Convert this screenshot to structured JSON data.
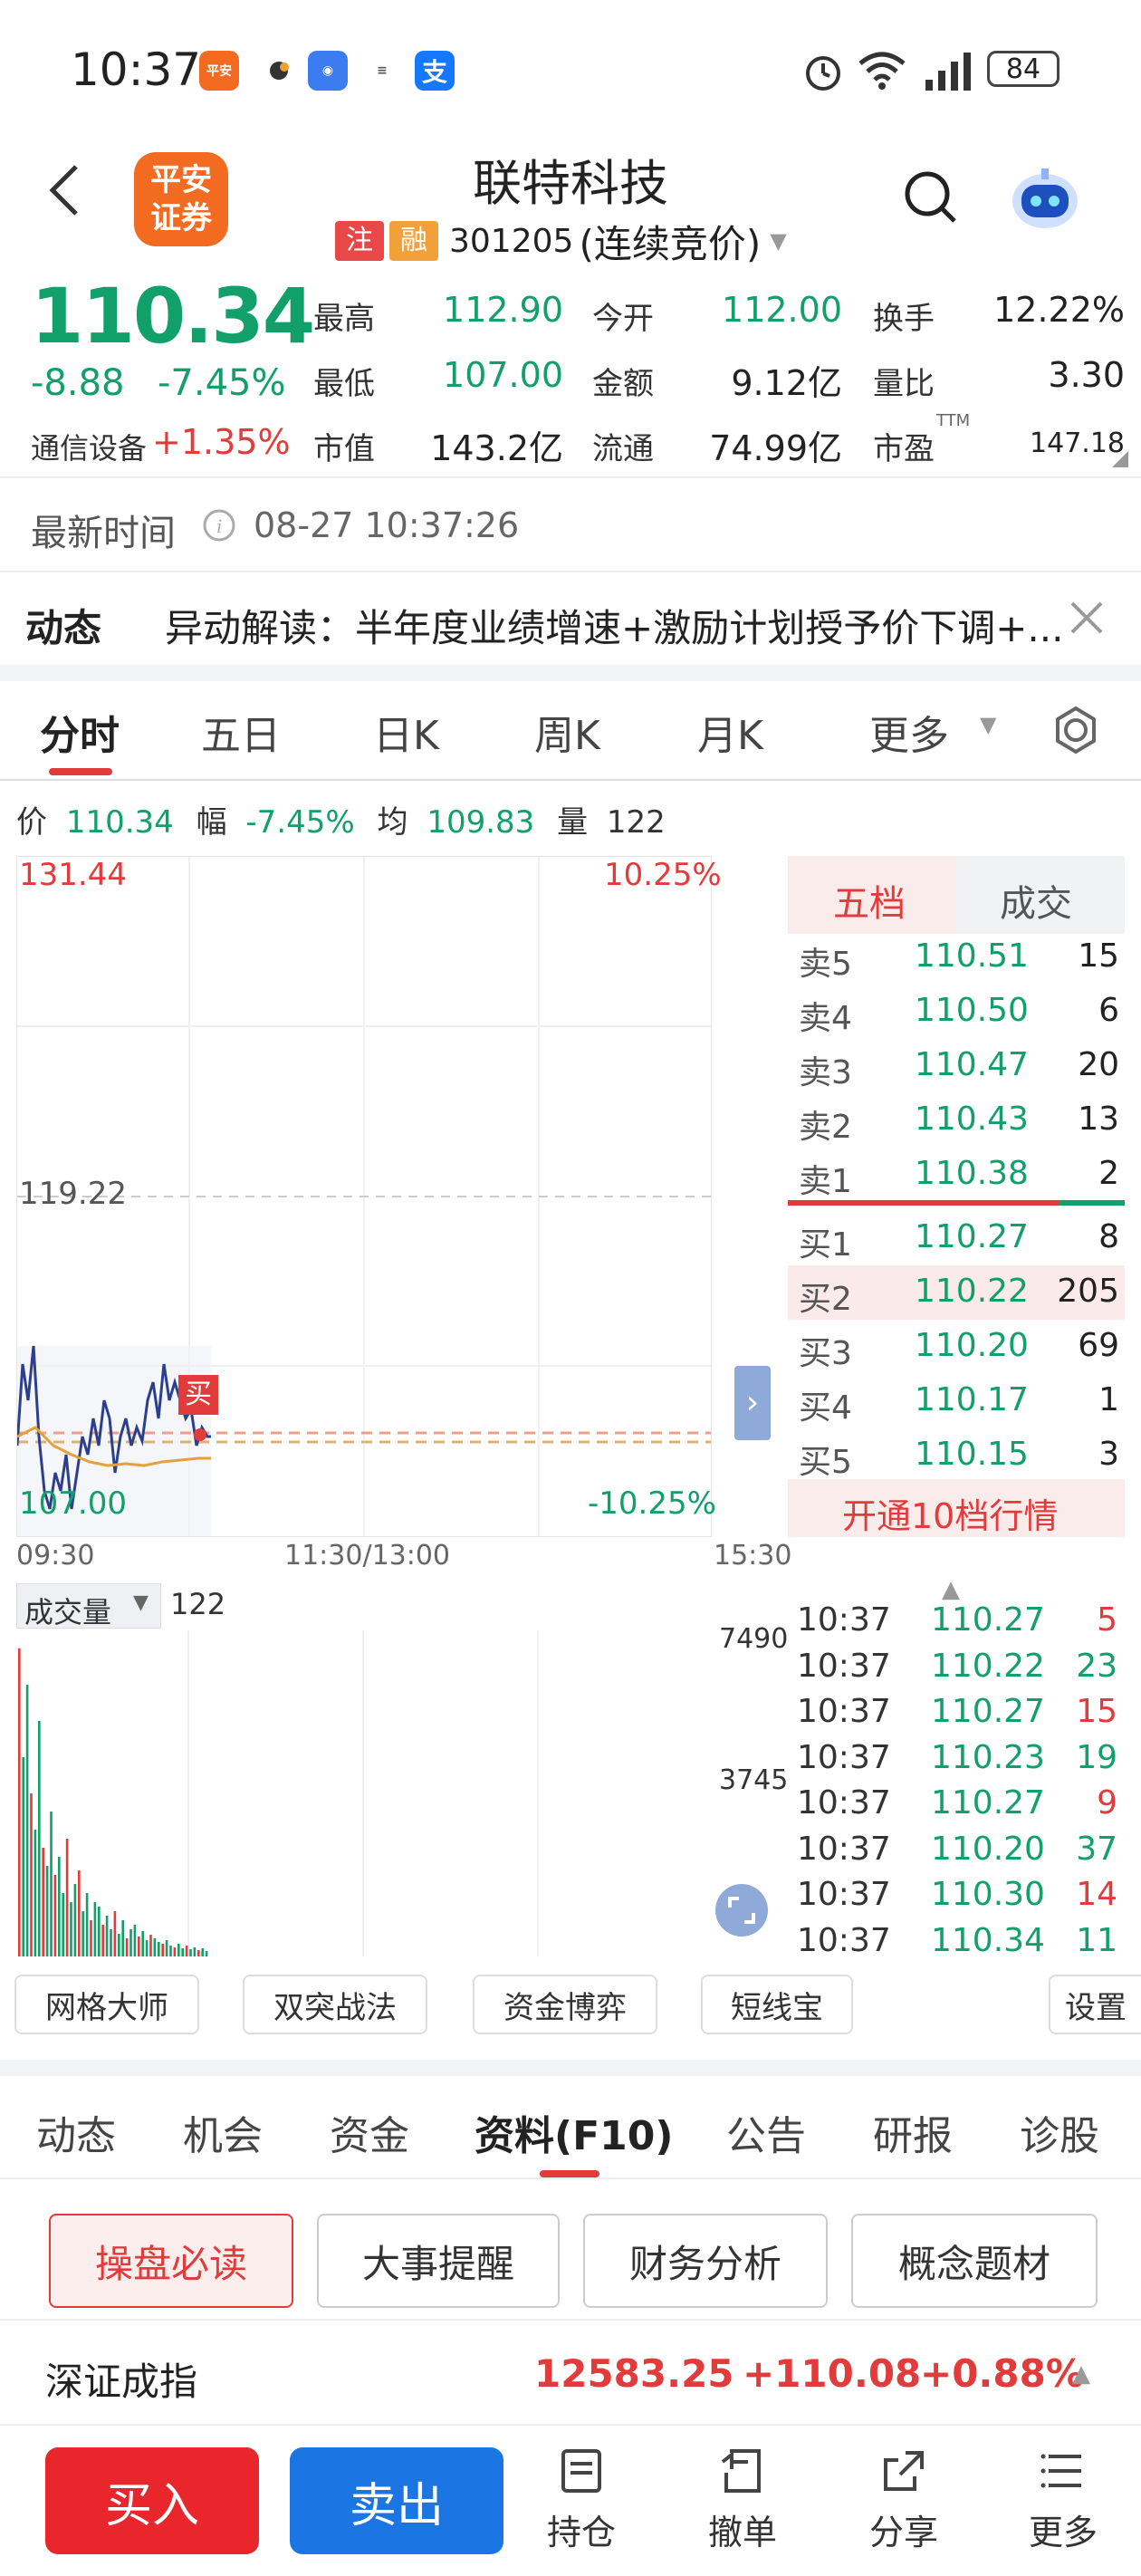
{
  "status_bar": {
    "time": "10:37",
    "battery": "84",
    "app_icons": [
      "平安证券",
      "bird-icon",
      "shield-app-icon",
      "bank-app-icon",
      "alipay-icon"
    ]
  },
  "header": {
    "title": "联特科技",
    "tag1": "注",
    "tag2": "融",
    "code": "301205",
    "mode": "(连续竞价)",
    "logo": "平安\n证券"
  },
  "quote": {
    "price": "110.34",
    "change": "-8.88",
    "change_pct": "-7.45%",
    "sector": "通信设备",
    "sector_change": "+1.35%",
    "high_label": "最高",
    "high": "112.90",
    "low_label": "最低",
    "low": "107.00",
    "mktcap_label": "市值",
    "mktcap": "143.2亿",
    "open_label": "今开",
    "open": "112.00",
    "amount_label": "金额",
    "amount": "9.12亿",
    "float_label": "流通",
    "float": "74.99亿",
    "turnover_label": "换手",
    "turnover": "12.22%",
    "volratio_label": "量比",
    "volratio": "3.30",
    "pe_label": "市盈",
    "pe_sup": "TTM",
    "pe": "147.18"
  },
  "update": {
    "label": "最新时间",
    "value": "08-27 10:37:26"
  },
  "news": {
    "label": "动态",
    "text": "异动解读：半年度业绩增速+激励计划授予价下调+..."
  },
  "chart_tabs": [
    "分时",
    "五日",
    "日K",
    "周K",
    "月K",
    "更多"
  ],
  "price_bar": {
    "p_label": "价",
    "p": "110.34",
    "f_label": "幅",
    "f": "-7.45%",
    "a_label": "均",
    "a": "109.83",
    "v_label": "量",
    "v": "122"
  },
  "chart_axis": {
    "top": "131.44",
    "top_pct": "10.25%",
    "mid": "119.22",
    "bottom": "107.00",
    "bottom_pct": "-10.25%",
    "t0": "09:30",
    "t1": "11:30/13:00",
    "t2": "15:30",
    "marker": "买"
  },
  "orderbook": {
    "tab1": "五档",
    "tab2": "成交",
    "asks": [
      {
        "label": "卖5",
        "price": "110.51",
        "vol": "15"
      },
      {
        "label": "卖4",
        "price": "110.50",
        "vol": "6"
      },
      {
        "label": "卖3",
        "price": "110.47",
        "vol": "20"
      },
      {
        "label": "卖2",
        "price": "110.43",
        "vol": "13"
      },
      {
        "label": "卖1",
        "price": "110.38",
        "vol": "2"
      }
    ],
    "bids": [
      {
        "label": "买1",
        "price": "110.27",
        "vol": "8"
      },
      {
        "label": "买2",
        "price": "110.22",
        "vol": "205"
      },
      {
        "label": "买3",
        "price": "110.20",
        "vol": "69"
      },
      {
        "label": "买4",
        "price": "110.17",
        "vol": "1"
      },
      {
        "label": "买5",
        "price": "110.15",
        "vol": "3"
      }
    ],
    "open10": "开通10档行情"
  },
  "volume": {
    "label": "成交量",
    "value": "122",
    "max": "7490",
    "mid": "3745"
  },
  "ticks": [
    {
      "t": "10:37",
      "p": "110.27",
      "v": "5",
      "c": "red"
    },
    {
      "t": "10:37",
      "p": "110.22",
      "v": "23",
      "c": "green"
    },
    {
      "t": "10:37",
      "p": "110.27",
      "v": "15",
      "c": "red"
    },
    {
      "t": "10:37",
      "p": "110.23",
      "v": "19",
      "c": "green"
    },
    {
      "t": "10:37",
      "p": "110.27",
      "v": "9",
      "c": "red"
    },
    {
      "t": "10:37",
      "p": "110.20",
      "v": "37",
      "c": "green"
    },
    {
      "t": "10:37",
      "p": "110.30",
      "v": "14",
      "c": "red"
    },
    {
      "t": "10:37",
      "p": "110.34",
      "v": "11",
      "c": "green"
    }
  ],
  "tools": [
    "网格大师",
    "双突战法",
    "资金博弈",
    "短线宝",
    "设置"
  ],
  "f_tabs": [
    "动态",
    "机会",
    "资金",
    "资料(F10)",
    "公告",
    "研报",
    "诊股"
  ],
  "sub_buttons": [
    "操盘必读",
    "大事提醒",
    "财务分析",
    "概念题材"
  ],
  "index": {
    "name": "深证成指",
    "value": "12583.25",
    "change": "+110.08",
    "pct": "+0.88%"
  },
  "bottom_nav": {
    "buy": "买入",
    "sell": "卖出",
    "items": [
      "持仓",
      "撤单",
      "分享",
      "更多"
    ]
  }
}
